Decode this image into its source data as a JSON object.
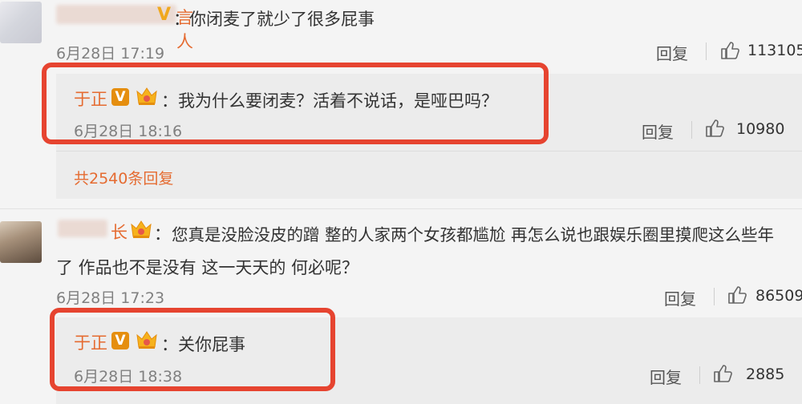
{
  "comments": [
    {
      "username": "言人",
      "text": "你闭麦了就少了很多屁事",
      "time": "6月28日 17:19",
      "reply_label": "回复",
      "likes": "113105",
      "reply": {
        "username": "于正",
        "text": "我为什么要闭麦？活着不说话，是哑巴吗？",
        "time": "6月28日 18:16",
        "reply_label": "回复",
        "likes": "10980"
      },
      "more_replies": "共2540条回复"
    },
    {
      "username": "长",
      "text_line1": "您真是没脸没皮的蹭 整的人家两个女孩都尴尬 再怎么说也跟娱乐圈里摸爬这么些年",
      "text_line2": "了 作品也不是没有 这一天天的 何必呢？",
      "time": "6月28日 17:23",
      "reply_label": "回复",
      "likes": "86509",
      "reply": {
        "username": "于正",
        "text": "关你屁事",
        "time": "6月28日 18:38",
        "reply_label": "回复",
        "likes": "2885"
      }
    }
  ],
  "badges": {
    "verified": "V"
  },
  "colors": {
    "highlight_frame": "#e64430",
    "username": "#e56b31",
    "verified": "#e58e0f"
  }
}
